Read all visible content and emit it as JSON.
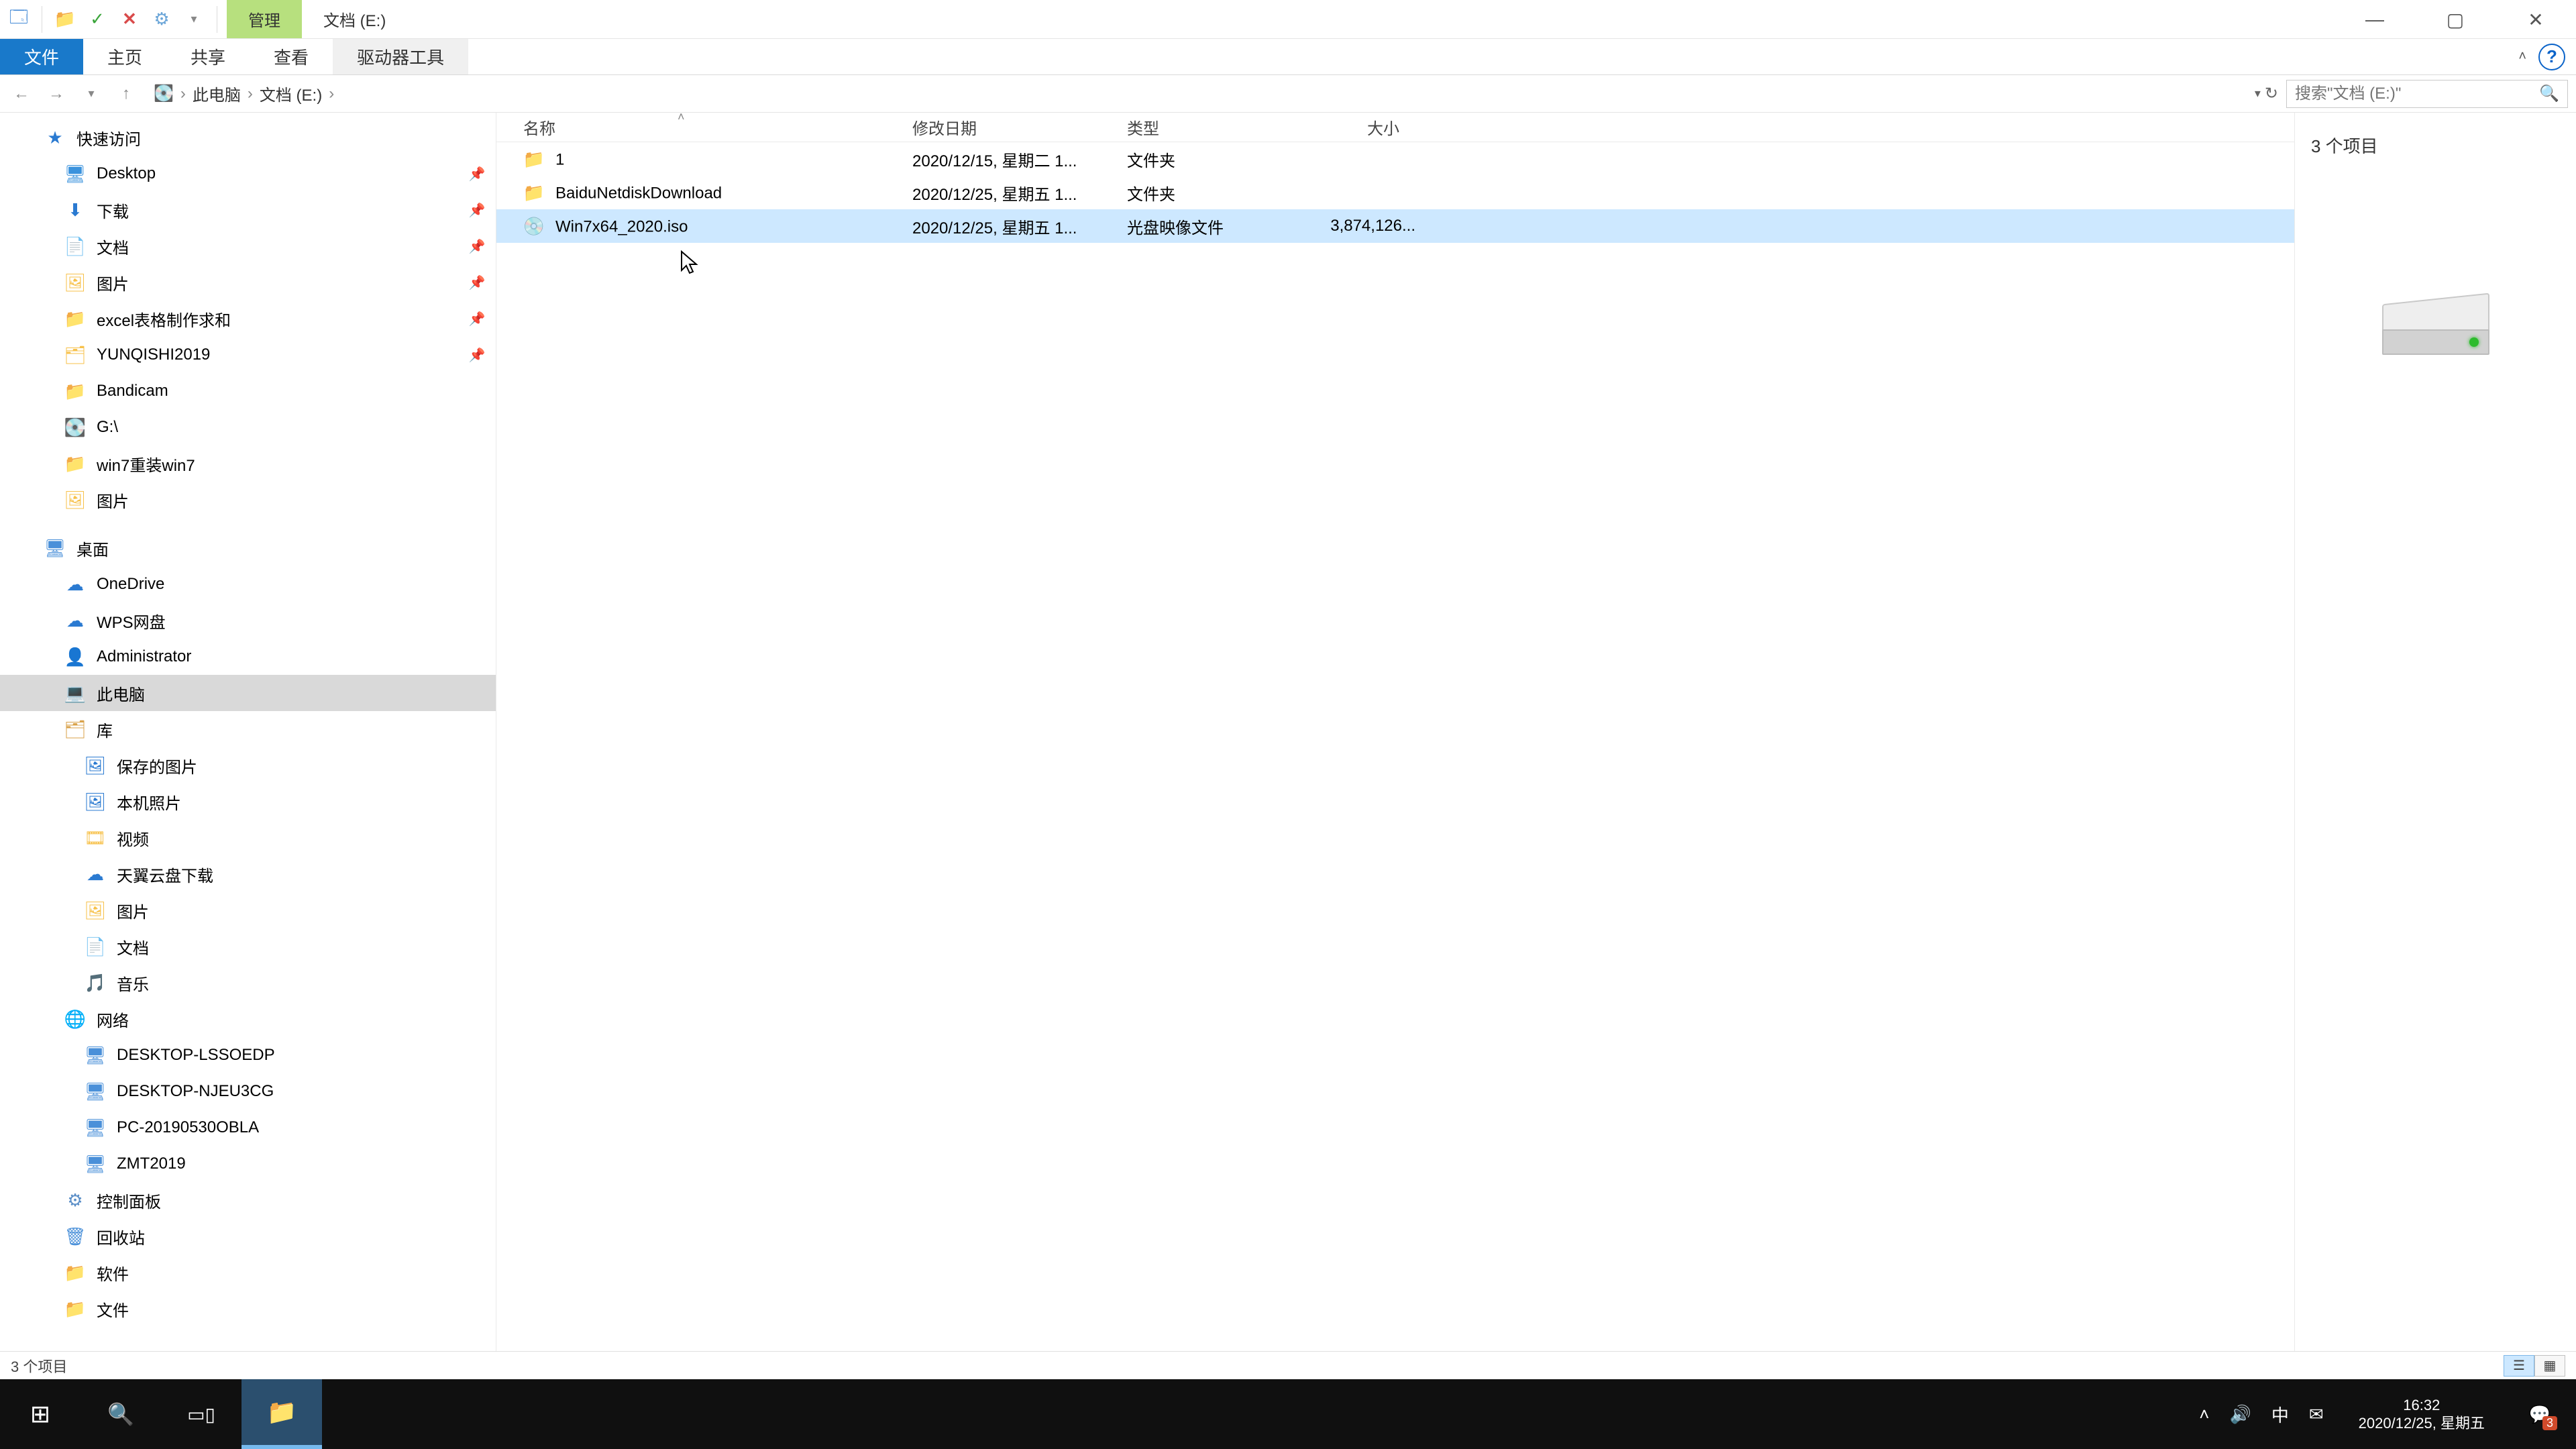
{
  "window": {
    "qa_icons": [
      "app-icon",
      "folder-icon",
      "check-icon",
      "close-blue-icon",
      "gear-icon",
      "dropdown-icon"
    ],
    "context_tab": "管理",
    "title": "文档 (E:)",
    "minimize": "—",
    "maximize": "▢",
    "close": "✕",
    "help": "?"
  },
  "ribbon": {
    "file": "文件",
    "home": "主页",
    "share": "共享",
    "view": "查看",
    "drive_tools": "驱动器工具"
  },
  "address": {
    "back": "←",
    "forward": "→",
    "recent": "▾",
    "up": "↑",
    "crumbs": [
      "此电脑",
      "文档 (E:)"
    ],
    "dropdown": "▾",
    "refresh": "↻",
    "search_placeholder": "搜索\"文档 (E:)\"",
    "search_icon": "🔍"
  },
  "nav": {
    "items": [
      {
        "indent": 50,
        "icon": "★",
        "icon_cls": "ic-star",
        "label": "快速访问",
        "pin": false
      },
      {
        "indent": 80,
        "icon": "🖥",
        "icon_cls": "ic-desk",
        "label": "Desktop",
        "pin": true
      },
      {
        "indent": 80,
        "icon": "⬇",
        "icon_cls": "ic-blue",
        "label": "下载",
        "pin": true
      },
      {
        "indent": 80,
        "icon": "📄",
        "icon_cls": "ic-folder",
        "label": "文档",
        "pin": true
      },
      {
        "indent": 80,
        "icon": "🖼",
        "icon_cls": "ic-folder",
        "label": "图片",
        "pin": true
      },
      {
        "indent": 80,
        "icon": "📁",
        "icon_cls": "ic-folder",
        "label": "excel表格制作求和",
        "pin": true
      },
      {
        "indent": 80,
        "icon": "🗂",
        "icon_cls": "ic-folder",
        "label": "YUNQISHI2019",
        "pin": true
      },
      {
        "indent": 80,
        "icon": "📁",
        "icon_cls": "ic-folder",
        "label": "Bandicam",
        "pin": false
      },
      {
        "indent": 80,
        "icon": "💽",
        "icon_cls": "ic-blue",
        "label": "G:\\",
        "pin": false
      },
      {
        "indent": 80,
        "icon": "📁",
        "icon_cls": "ic-folder",
        "label": "win7重装win7",
        "pin": false
      },
      {
        "indent": 80,
        "icon": "🖼",
        "icon_cls": "ic-folder",
        "label": "图片",
        "pin": false
      },
      {
        "indent": 50,
        "icon": "🖥",
        "icon_cls": "ic-pc",
        "label": "桌面",
        "pin": false
      },
      {
        "indent": 80,
        "icon": "☁",
        "icon_cls": "ic-cloud",
        "label": "OneDrive",
        "pin": false
      },
      {
        "indent": 80,
        "icon": "☁",
        "icon_cls": "ic-cloud",
        "label": "WPS网盘",
        "pin": false
      },
      {
        "indent": 80,
        "icon": "👤",
        "icon_cls": "ic-folder",
        "label": "Administrator",
        "pin": false
      },
      {
        "indent": 80,
        "icon": "💻",
        "icon_cls": "ic-pc",
        "label": "此电脑",
        "pin": false,
        "selected": true
      },
      {
        "indent": 80,
        "icon": "🗂",
        "icon_cls": "ic-lib",
        "label": "库",
        "pin": false
      },
      {
        "indent": 110,
        "icon": "🖼",
        "icon_cls": "ic-blue",
        "label": "保存的图片",
        "pin": false
      },
      {
        "indent": 110,
        "icon": "🖼",
        "icon_cls": "ic-blue",
        "label": "本机照片",
        "pin": false
      },
      {
        "indent": 110,
        "icon": "🎞",
        "icon_cls": "ic-folder",
        "label": "视频",
        "pin": false
      },
      {
        "indent": 110,
        "icon": "☁",
        "icon_cls": "ic-blue",
        "label": "天翼云盘下载",
        "pin": false
      },
      {
        "indent": 110,
        "icon": "🖼",
        "icon_cls": "ic-folder",
        "label": "图片",
        "pin": false
      },
      {
        "indent": 110,
        "icon": "📄",
        "icon_cls": "ic-folder",
        "label": "文档",
        "pin": false
      },
      {
        "indent": 110,
        "icon": "🎵",
        "icon_cls": "ic-folder",
        "label": "音乐",
        "pin": false
      },
      {
        "indent": 80,
        "icon": "🌐",
        "icon_cls": "ic-net",
        "label": "网络",
        "pin": false
      },
      {
        "indent": 110,
        "icon": "🖥",
        "icon_cls": "ic-pc",
        "label": "DESKTOP-LSSOEDP",
        "pin": false
      },
      {
        "indent": 110,
        "icon": "🖥",
        "icon_cls": "ic-pc",
        "label": "DESKTOP-NJEU3CG",
        "pin": false
      },
      {
        "indent": 110,
        "icon": "🖥",
        "icon_cls": "ic-pc",
        "label": "PC-20190530OBLA",
        "pin": false
      },
      {
        "indent": 110,
        "icon": "🖥",
        "icon_cls": "ic-pc",
        "label": "ZMT2019",
        "pin": false
      },
      {
        "indent": 80,
        "icon": "⚙",
        "icon_cls": "ic-ctrl",
        "label": "控制面板",
        "pin": false
      },
      {
        "indent": 80,
        "icon": "🗑",
        "icon_cls": "ic-recycle",
        "label": "回收站",
        "pin": false
      },
      {
        "indent": 80,
        "icon": "📁",
        "icon_cls": "ic-folder",
        "label": "软件",
        "pin": false
      },
      {
        "indent": 80,
        "icon": "📁",
        "icon_cls": "ic-folder",
        "label": "文件",
        "pin": false
      }
    ]
  },
  "columns": {
    "name": "名称",
    "date": "修改日期",
    "type": "类型",
    "size": "大小"
  },
  "files": [
    {
      "icon": "📁",
      "icon_cls": "ic-folder",
      "name": "1",
      "date": "2020/12/15, 星期二 1...",
      "type": "文件夹",
      "size": "",
      "selected": false
    },
    {
      "icon": "📁",
      "icon_cls": "ic-folder",
      "name": "BaiduNetdiskDownload",
      "date": "2020/12/25, 星期五 1...",
      "type": "文件夹",
      "size": "",
      "selected": false
    },
    {
      "icon": "💿",
      "icon_cls": "ic-disc",
      "name": "Win7x64_2020.iso",
      "date": "2020/12/25, 星期五 1...",
      "type": "光盘映像文件",
      "size": "3,874,126...",
      "selected": true
    }
  ],
  "details": {
    "count_label": "3 个项目"
  },
  "status": {
    "left": "3 个项目"
  },
  "taskbar": {
    "start": "⊞",
    "search": "🔍",
    "taskview": "▭▯",
    "explorer": "📁",
    "tray": {
      "chevron": "˄",
      "volume": "🔊",
      "ime": "中",
      "mail": "✉"
    },
    "clock": {
      "time": "16:32",
      "date": "2020/12/25, 星期五"
    },
    "notif_count": "3"
  }
}
